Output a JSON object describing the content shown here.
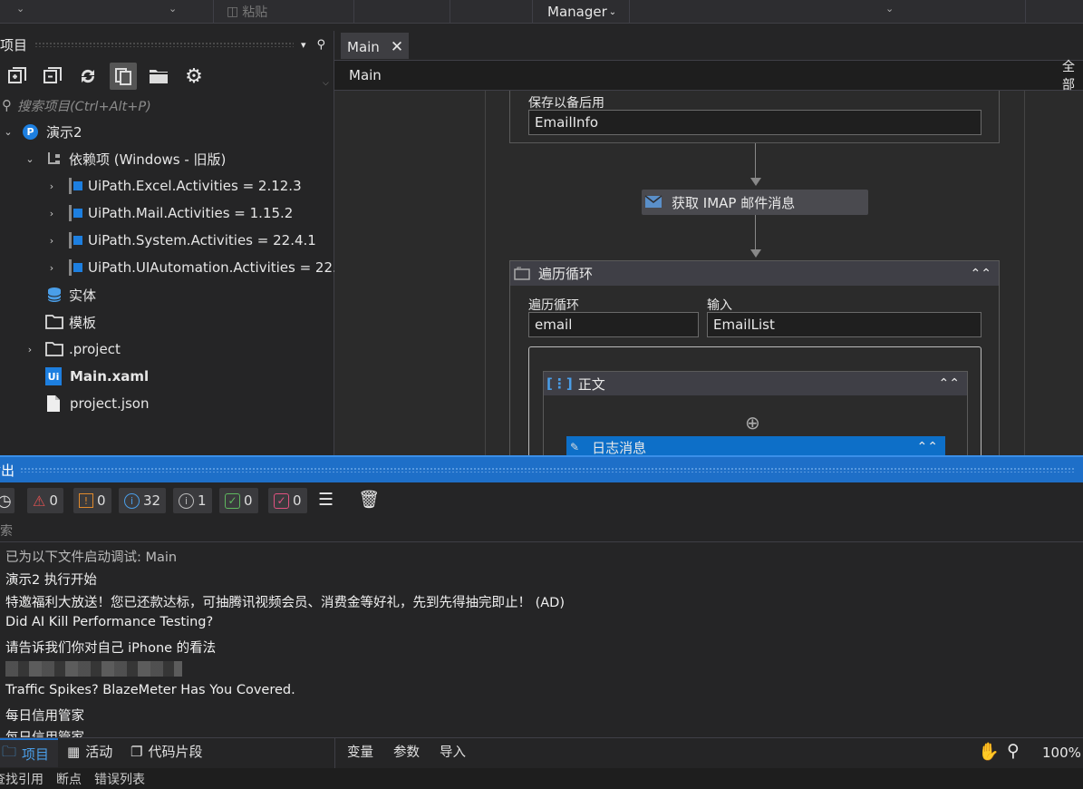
{
  "topbar": {
    "paste_label": "粘贴",
    "manager_label": "Manager"
  },
  "project_panel": {
    "title": "项目",
    "search_placeholder": "搜索项目(Ctrl+Alt+P)",
    "tree": {
      "root": "演示2",
      "dependencies": "依赖项 (Windows - 旧版)",
      "packages": [
        "UiPath.Excel.Activities = 2.12.3",
        "UiPath.Mail.Activities = 1.15.2",
        "UiPath.System.Activities = 22.4.1",
        "UiPath.UIAutomation.Activities = 22."
      ],
      "entities": "实体",
      "templates": "模板",
      "project_folder": ".project",
      "main_file": "Main.xaml",
      "project_json": "project.json"
    }
  },
  "designer": {
    "tab_label": "Main",
    "breadcrumb": "Main",
    "expand_all": "全部",
    "save_label": "保存以备后用",
    "save_value": "EmailInfo",
    "imap_activity": "获取 IMAP 邮件消息",
    "foreach_title": "遍历循环",
    "foreach_var_label": "遍历循环",
    "foreach_var_value": "email",
    "foreach_input_label": "输入",
    "foreach_input_value": "EmailList",
    "body_title": "正文",
    "log_title": "日志消息"
  },
  "output_panel": {
    "title": "输出",
    "filters": [
      {
        "name": "errors",
        "count": "0",
        "color": "#e05252"
      },
      {
        "name": "warnings",
        "count": "0",
        "color": "#e08a2c"
      },
      {
        "name": "info",
        "count": "32",
        "color": "#4a9ee8"
      },
      {
        "name": "trace",
        "count": "1",
        "color": "#bbbbbb"
      },
      {
        "name": "success",
        "count": "0",
        "color": "#5fb85f"
      },
      {
        "name": "failed",
        "count": "0",
        "color": "#e05280"
      }
    ],
    "search_placeholder": "搜索",
    "lines": [
      "已为以下文件启动调试: Main",
      "演示2 执行开始",
      "特邀福利大放送！您已还款达标，可抽腾讯视频会员、消费金等好礼，先到先得抽完即止！ (AD)",
      "Did AI Kill Performance Testing?",
      "请告诉我们你对自己 iPhone 的看法",
      "Traffic Spikes? BlazeMeter Has You Covered.",
      "每日信用管家"
    ]
  },
  "bottom_tabs": {
    "left": [
      "项目",
      "活动",
      "代码片段"
    ],
    "right": [
      "变量",
      "参数",
      "导入"
    ],
    "zoom": "100%"
  },
  "status_tabs": [
    "查找引用",
    "断点",
    "错误列表"
  ]
}
